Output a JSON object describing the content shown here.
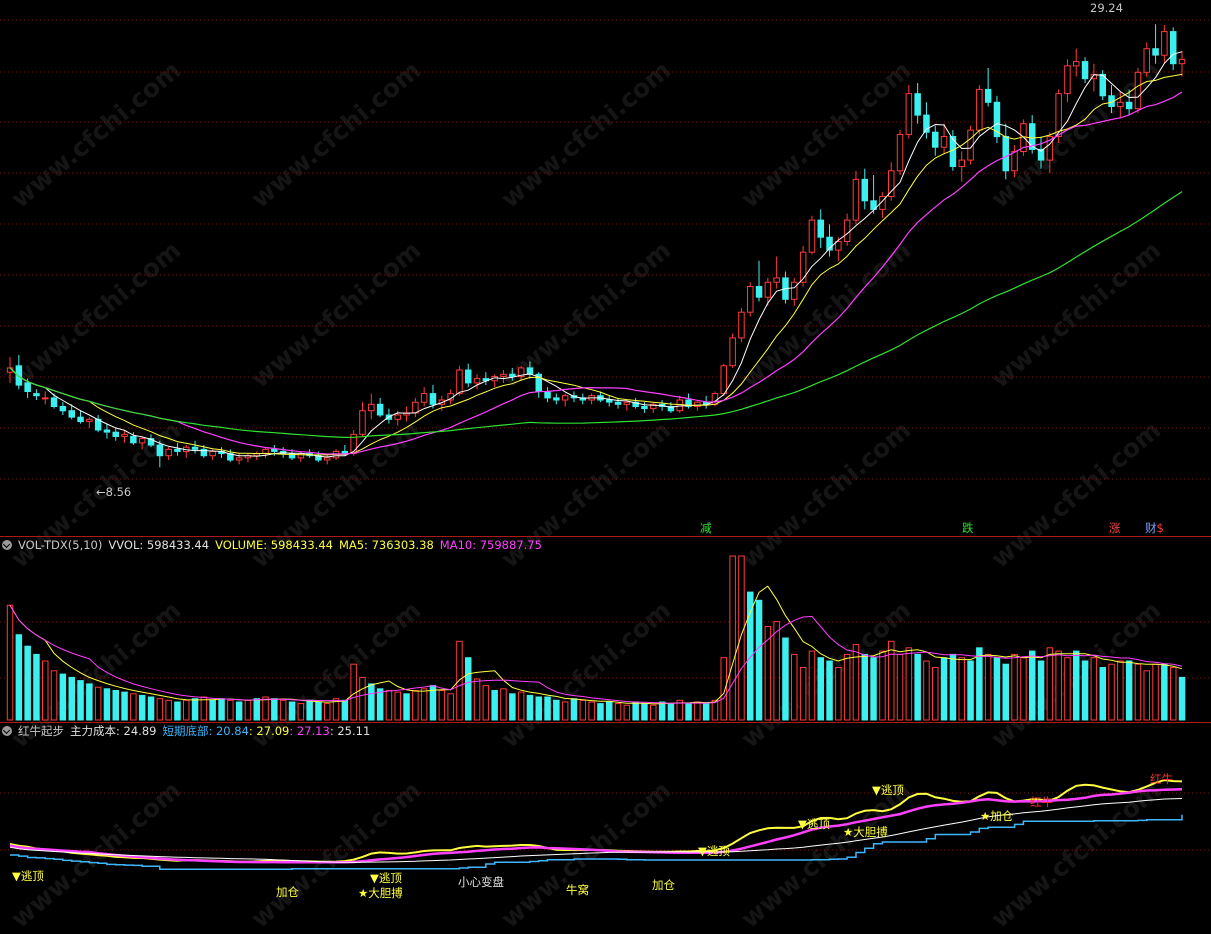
{
  "watermark": "www.cfchi.com",
  "colors": {
    "up": "#ff3b3b",
    "down": "#3df0f0",
    "ma5": "#ffffff",
    "ma10": "#ffff40",
    "ma20": "#ff40ff",
    "ma60": "#30e030",
    "grid": "#7a1515"
  },
  "main_panel": {
    "high_label": "29.24",
    "low_label": "8.56",
    "marks": [
      {
        "text": "减",
        "color": "#30e030"
      },
      {
        "text": "跌",
        "color": "#30e030"
      },
      {
        "text": "涨",
        "color": "#ff4040"
      },
      {
        "text": "财",
        "color": "#7fa0ff"
      },
      {
        "text": "$",
        "color": "#ff4040"
      }
    ]
  },
  "volume_header": {
    "name": "VOL-TDX(5,10)",
    "vvol": "VVOL: 598433.44",
    "volume": "VOLUME: 598433.44",
    "ma5": "MA5: 736303.38",
    "ma10": "MA10: 759887.75"
  },
  "indicator_header": {
    "name": "红牛起步",
    "cost": "主力成本: 24.89",
    "bottom": "短期底部: 20.84",
    "v1": ": 27.09",
    "v2": ": 27.13",
    "v3": ": 25.11"
  },
  "indicator_labels": [
    {
      "text": "▼逃顶",
      "color": "#ffff40"
    },
    {
      "text": "加仓",
      "color": "#ffff40"
    },
    {
      "text": "▼逃顶",
      "color": "#ffff40"
    },
    {
      "text": "★大胆搏",
      "color": "#ffff40"
    },
    {
      "text": "小心变盘",
      "color": "#e0e0e0"
    },
    {
      "text": "牛窝",
      "color": "#ffff40"
    },
    {
      "text": "加仓",
      "color": "#ffff40"
    },
    {
      "text": "▼逃顶",
      "color": "#ffff40"
    },
    {
      "text": "▼逃顶",
      "color": "#ffff40"
    },
    {
      "text": "★大胆搏",
      "color": "#ffff40"
    },
    {
      "text": "▼逃顶",
      "color": "#ffff40"
    },
    {
      "text": "★加仓",
      "color": "#ffff40"
    },
    {
      "text": "红牛",
      "color": "#ff3030"
    },
    {
      "text": "红牛",
      "color": "#ff3030"
    }
  ],
  "chart_data": {
    "type": "candlestick",
    "ylim": [
      7.5,
      30
    ],
    "candles": [
      [
        13.0,
        13.7,
        12.5,
        13.2
      ],
      [
        13.3,
        13.8,
        12.2,
        12.4
      ],
      [
        12.5,
        12.7,
        11.8,
        12.1
      ],
      [
        12.0,
        12.2,
        11.7,
        11.9
      ],
      [
        11.8,
        12.1,
        11.5,
        11.8
      ],
      [
        11.8,
        12.0,
        11.3,
        11.4
      ],
      [
        11.4,
        11.6,
        11.0,
        11.2
      ],
      [
        11.2,
        11.5,
        10.8,
        10.9
      ],
      [
        10.9,
        11.2,
        10.6,
        10.7
      ],
      [
        10.7,
        10.9,
        10.4,
        10.8
      ],
      [
        10.8,
        11.0,
        10.2,
        10.3
      ],
      [
        10.3,
        10.6,
        9.9,
        10.2
      ],
      [
        10.2,
        10.4,
        9.8,
        10.0
      ],
      [
        10.0,
        10.3,
        9.7,
        10.1
      ],
      [
        10.0,
        10.2,
        9.6,
        9.7
      ],
      [
        9.7,
        10.0,
        9.4,
        9.9
      ],
      [
        9.9,
        10.1,
        9.5,
        9.6
      ],
      [
        9.6,
        9.8,
        8.56,
        9.1
      ],
      [
        9.1,
        9.5,
        8.9,
        9.4
      ],
      [
        9.4,
        9.7,
        9.1,
        9.3
      ],
      [
        9.3,
        9.6,
        9.0,
        9.5
      ],
      [
        9.5,
        9.8,
        9.2,
        9.4
      ],
      [
        9.4,
        9.6,
        9.0,
        9.1
      ],
      [
        9.1,
        9.4,
        8.9,
        9.3
      ],
      [
        9.3,
        9.5,
        9.0,
        9.2
      ],
      [
        9.2,
        9.4,
        8.8,
        8.9
      ],
      [
        8.9,
        9.2,
        8.7,
        9.0
      ],
      [
        9.0,
        9.2,
        8.8,
        9.1
      ],
      [
        9.1,
        9.3,
        8.9,
        9.2
      ],
      [
        9.2,
        9.5,
        9.0,
        9.4
      ],
      [
        9.4,
        9.6,
        9.1,
        9.3
      ],
      [
        9.3,
        9.5,
        9.0,
        9.2
      ],
      [
        9.2,
        9.4,
        8.9,
        9.0
      ],
      [
        9.0,
        9.3,
        8.8,
        9.2
      ],
      [
        9.2,
        9.4,
        9.0,
        9.1
      ],
      [
        9.1,
        9.3,
        8.8,
        8.9
      ],
      [
        8.9,
        9.2,
        8.7,
        9.0
      ],
      [
        9.0,
        9.4,
        8.9,
        9.3
      ],
      [
        9.3,
        9.6,
        9.1,
        9.2
      ],
      [
        9.2,
        10.3,
        9.1,
        10.1
      ],
      [
        10.1,
        11.6,
        10.0,
        11.2
      ],
      [
        11.2,
        12.0,
        10.8,
        11.5
      ],
      [
        11.5,
        11.8,
        10.9,
        11.0
      ],
      [
        11.0,
        11.3,
        10.6,
        10.8
      ],
      [
        10.8,
        11.2,
        10.5,
        11.0
      ],
      [
        11.0,
        11.4,
        10.7,
        11.1
      ],
      [
        11.1,
        11.8,
        10.9,
        11.6
      ],
      [
        11.6,
        12.3,
        11.4,
        12.0
      ],
      [
        12.0,
        12.4,
        11.3,
        11.5
      ],
      [
        11.5,
        11.9,
        11.2,
        11.7
      ],
      [
        11.7,
        12.2,
        11.5,
        12.0
      ],
      [
        12.0,
        13.3,
        11.9,
        13.1
      ],
      [
        13.1,
        13.4,
        12.3,
        12.5
      ],
      [
        12.5,
        12.9,
        12.2,
        12.7
      ],
      [
        12.7,
        13.0,
        12.4,
        12.6
      ],
      [
        12.6,
        12.9,
        12.3,
        12.8
      ],
      [
        12.8,
        13.1,
        12.5,
        12.9
      ],
      [
        12.9,
        13.2,
        12.6,
        12.8
      ],
      [
        12.8,
        13.3,
        12.6,
        13.2
      ],
      [
        13.2,
        13.5,
        12.7,
        12.9
      ],
      [
        12.9,
        13.0,
        11.8,
        12.1
      ],
      [
        12.1,
        12.3,
        11.6,
        11.8
      ],
      [
        11.8,
        12.0,
        11.5,
        11.7
      ],
      [
        11.7,
        12.0,
        11.4,
        11.9
      ],
      [
        11.9,
        12.1,
        11.6,
        11.8
      ],
      [
        11.8,
        12.0,
        11.5,
        11.7
      ],
      [
        11.7,
        12.0,
        11.5,
        11.9
      ],
      [
        11.9,
        12.1,
        11.6,
        11.7
      ],
      [
        11.7,
        11.9,
        11.4,
        11.6
      ],
      [
        11.6,
        11.8,
        11.3,
        11.5
      ],
      [
        11.5,
        11.7,
        11.2,
        11.6
      ],
      [
        11.6,
        11.8,
        11.3,
        11.4
      ],
      [
        11.4,
        11.6,
        11.1,
        11.3
      ],
      [
        11.3,
        11.6,
        11.1,
        11.5
      ],
      [
        11.5,
        11.7,
        11.2,
        11.4
      ],
      [
        11.4,
        11.6,
        11.1,
        11.2
      ],
      [
        11.2,
        11.9,
        11.1,
        11.7
      ],
      [
        11.7,
        12.0,
        11.3,
        11.4
      ],
      [
        11.4,
        11.7,
        11.2,
        11.6
      ],
      [
        11.6,
        11.9,
        11.3,
        11.5
      ],
      [
        11.5,
        12.1,
        11.4,
        12.0
      ],
      [
        12.0,
        13.4,
        11.9,
        13.3
      ],
      [
        13.3,
        14.8,
        13.2,
        14.6
      ],
      [
        14.6,
        16.0,
        14.4,
        15.8
      ],
      [
        15.8,
        17.2,
        15.6,
        17.0
      ],
      [
        17.0,
        18.2,
        16.3,
        16.5
      ],
      [
        16.5,
        17.4,
        16.1,
        17.2
      ],
      [
        17.2,
        18.4,
        16.9,
        17.4
      ],
      [
        17.4,
        17.7,
        16.2,
        16.4
      ],
      [
        16.4,
        17.4,
        16.1,
        17.2
      ],
      [
        17.2,
        18.9,
        17.0,
        18.6
      ],
      [
        18.6,
        20.3,
        18.5,
        20.1
      ],
      [
        20.1,
        20.6,
        18.8,
        19.3
      ],
      [
        19.3,
        19.9,
        18.4,
        18.7
      ],
      [
        18.7,
        19.3,
        18.2,
        19.1
      ],
      [
        19.1,
        20.4,
        18.9,
        20.1
      ],
      [
        20.1,
        22.4,
        19.9,
        22.0
      ],
      [
        22.0,
        22.5,
        20.6,
        21.0
      ],
      [
        21.0,
        22.2,
        20.4,
        20.6
      ],
      [
        20.6,
        21.4,
        20.2,
        21.2
      ],
      [
        21.2,
        22.8,
        21.0,
        22.4
      ],
      [
        22.4,
        24.3,
        22.2,
        24.1
      ],
      [
        24.1,
        26.4,
        23.9,
        26.0
      ],
      [
        26.0,
        26.5,
        24.6,
        25.0
      ],
      [
        25.0,
        25.6,
        23.9,
        24.2
      ],
      [
        24.2,
        24.5,
        23.1,
        23.5
      ],
      [
        23.5,
        24.6,
        23.2,
        24.0
      ],
      [
        24.0,
        24.3,
        22.4,
        22.6
      ],
      [
        22.6,
        23.3,
        21.9,
        22.9
      ],
      [
        22.9,
        24.5,
        22.7,
        24.3
      ],
      [
        24.3,
        26.4,
        24.1,
        26.2
      ],
      [
        26.2,
        27.2,
        25.4,
        25.6
      ],
      [
        25.6,
        25.9,
        23.7,
        24.0
      ],
      [
        24.0,
        24.6,
        22.0,
        22.4
      ],
      [
        22.4,
        23.6,
        22.1,
        23.3
      ],
      [
        23.3,
        24.8,
        23.1,
        24.6
      ],
      [
        24.6,
        25.0,
        23.2,
        23.4
      ],
      [
        23.4,
        24.0,
        22.5,
        22.9
      ],
      [
        22.9,
        24.2,
        22.3,
        24.0
      ],
      [
        24.0,
        26.2,
        23.7,
        26.0
      ],
      [
        26.0,
        27.6,
        25.6,
        27.3
      ],
      [
        27.3,
        28.1,
        26.8,
        27.5
      ],
      [
        27.5,
        27.7,
        26.5,
        26.7
      ],
      [
        26.7,
        27.4,
        26.1,
        26.9
      ],
      [
        26.9,
        27.1,
        25.7,
        25.9
      ],
      [
        25.9,
        26.4,
        25.1,
        25.4
      ],
      [
        25.4,
        26.1,
        24.9,
        25.6
      ],
      [
        25.6,
        26.2,
        25.0,
        25.3
      ],
      [
        25.3,
        27.2,
        25.1,
        27.0
      ],
      [
        27.0,
        28.4,
        26.8,
        28.1
      ],
      [
        28.1,
        29.24,
        27.4,
        27.8
      ],
      [
        27.8,
        29.2,
        27.4,
        28.9
      ],
      [
        28.9,
        29.1,
        27.1,
        27.4
      ],
      [
        27.4,
        28.0,
        26.8,
        27.6
      ]
    ],
    "vol_ylim": [
      0,
      100
    ],
    "volume": [
      [
        70,
        1
      ],
      [
        52,
        0
      ],
      [
        45,
        0
      ],
      [
        40,
        0
      ],
      [
        36,
        1
      ],
      [
        30,
        1
      ],
      [
        28,
        0
      ],
      [
        26,
        0
      ],
      [
        24,
        0
      ],
      [
        22,
        0
      ],
      [
        20,
        1
      ],
      [
        19,
        0
      ],
      [
        18,
        0
      ],
      [
        17,
        0
      ],
      [
        16,
        1
      ],
      [
        15,
        0
      ],
      [
        14,
        0
      ],
      [
        13,
        1
      ],
      [
        12,
        1
      ],
      [
        11,
        0
      ],
      [
        12,
        1
      ],
      [
        13,
        0
      ],
      [
        14,
        1
      ],
      [
        12,
        0
      ],
      [
        13,
        0
      ],
      [
        12,
        1
      ],
      [
        11,
        0
      ],
      [
        12,
        1
      ],
      [
        13,
        0
      ],
      [
        14,
        1
      ],
      [
        13,
        0
      ],
      [
        12,
        1
      ],
      [
        11,
        0
      ],
      [
        10,
        1
      ],
      [
        12,
        0
      ],
      [
        11,
        0
      ],
      [
        10,
        1
      ],
      [
        13,
        1
      ],
      [
        12,
        0
      ],
      [
        34,
        1
      ],
      [
        26,
        1
      ],
      [
        22,
        0
      ],
      [
        19,
        0
      ],
      [
        18,
        1
      ],
      [
        17,
        1
      ],
      [
        16,
        0
      ],
      [
        18,
        1
      ],
      [
        19,
        1
      ],
      [
        21,
        0
      ],
      [
        18,
        1
      ],
      [
        16,
        1
      ],
      [
        48,
        1
      ],
      [
        38,
        0
      ],
      [
        25,
        1
      ],
      [
        21,
        1
      ],
      [
        18,
        0
      ],
      [
        19,
        1
      ],
      [
        16,
        0
      ],
      [
        17,
        1
      ],
      [
        15,
        0
      ],
      [
        14,
        0
      ],
      [
        14,
        0
      ],
      [
        12,
        0
      ],
      [
        11,
        1
      ],
      [
        13,
        0
      ],
      [
        12,
        1
      ],
      [
        11,
        1
      ],
      [
        10,
        0
      ],
      [
        11,
        0
      ],
      [
        10,
        1
      ],
      [
        9,
        1
      ],
      [
        11,
        0
      ],
      [
        10,
        0
      ],
      [
        9,
        1
      ],
      [
        11,
        0
      ],
      [
        10,
        0
      ],
      [
        12,
        1
      ],
      [
        10,
        0
      ],
      [
        11,
        1
      ],
      [
        10,
        0
      ],
      [
        12,
        1
      ],
      [
        38,
        1
      ],
      [
        100,
        1
      ],
      [
        100,
        1
      ],
      [
        78,
        0
      ],
      [
        73,
        0
      ],
      [
        57,
        1
      ],
      [
        60,
        1
      ],
      [
        50,
        0
      ],
      [
        40,
        1
      ],
      [
        32,
        1
      ],
      [
        42,
        1
      ],
      [
        38,
        0
      ],
      [
        36,
        0
      ],
      [
        32,
        1
      ],
      [
        40,
        1
      ],
      [
        46,
        1
      ],
      [
        40,
        0
      ],
      [
        38,
        0
      ],
      [
        42,
        1
      ],
      [
        48,
        1
      ],
      [
        40,
        1
      ],
      [
        44,
        1
      ],
      [
        40,
        0
      ],
      [
        36,
        1
      ],
      [
        32,
        1
      ],
      [
        38,
        0
      ],
      [
        40,
        0
      ],
      [
        38,
        1
      ],
      [
        36,
        0
      ],
      [
        44,
        0
      ],
      [
        40,
        1
      ],
      [
        38,
        0
      ],
      [
        34,
        0
      ],
      [
        40,
        1
      ],
      [
        38,
        1
      ],
      [
        42,
        0
      ],
      [
        36,
        0
      ],
      [
        44,
        1
      ],
      [
        42,
        1
      ],
      [
        38,
        1
      ],
      [
        42,
        0
      ],
      [
        36,
        0
      ],
      [
        38,
        1
      ],
      [
        32,
        0
      ],
      [
        34,
        1
      ],
      [
        36,
        1
      ],
      [
        36,
        0
      ],
      [
        34,
        1
      ],
      [
        30,
        1
      ],
      [
        34,
        1
      ],
      [
        34,
        0
      ],
      [
        32,
        1
      ],
      [
        26,
        0
      ]
    ],
    "ind_ylim": [
      0,
      40
    ],
    "ind_x_max": 133
  }
}
